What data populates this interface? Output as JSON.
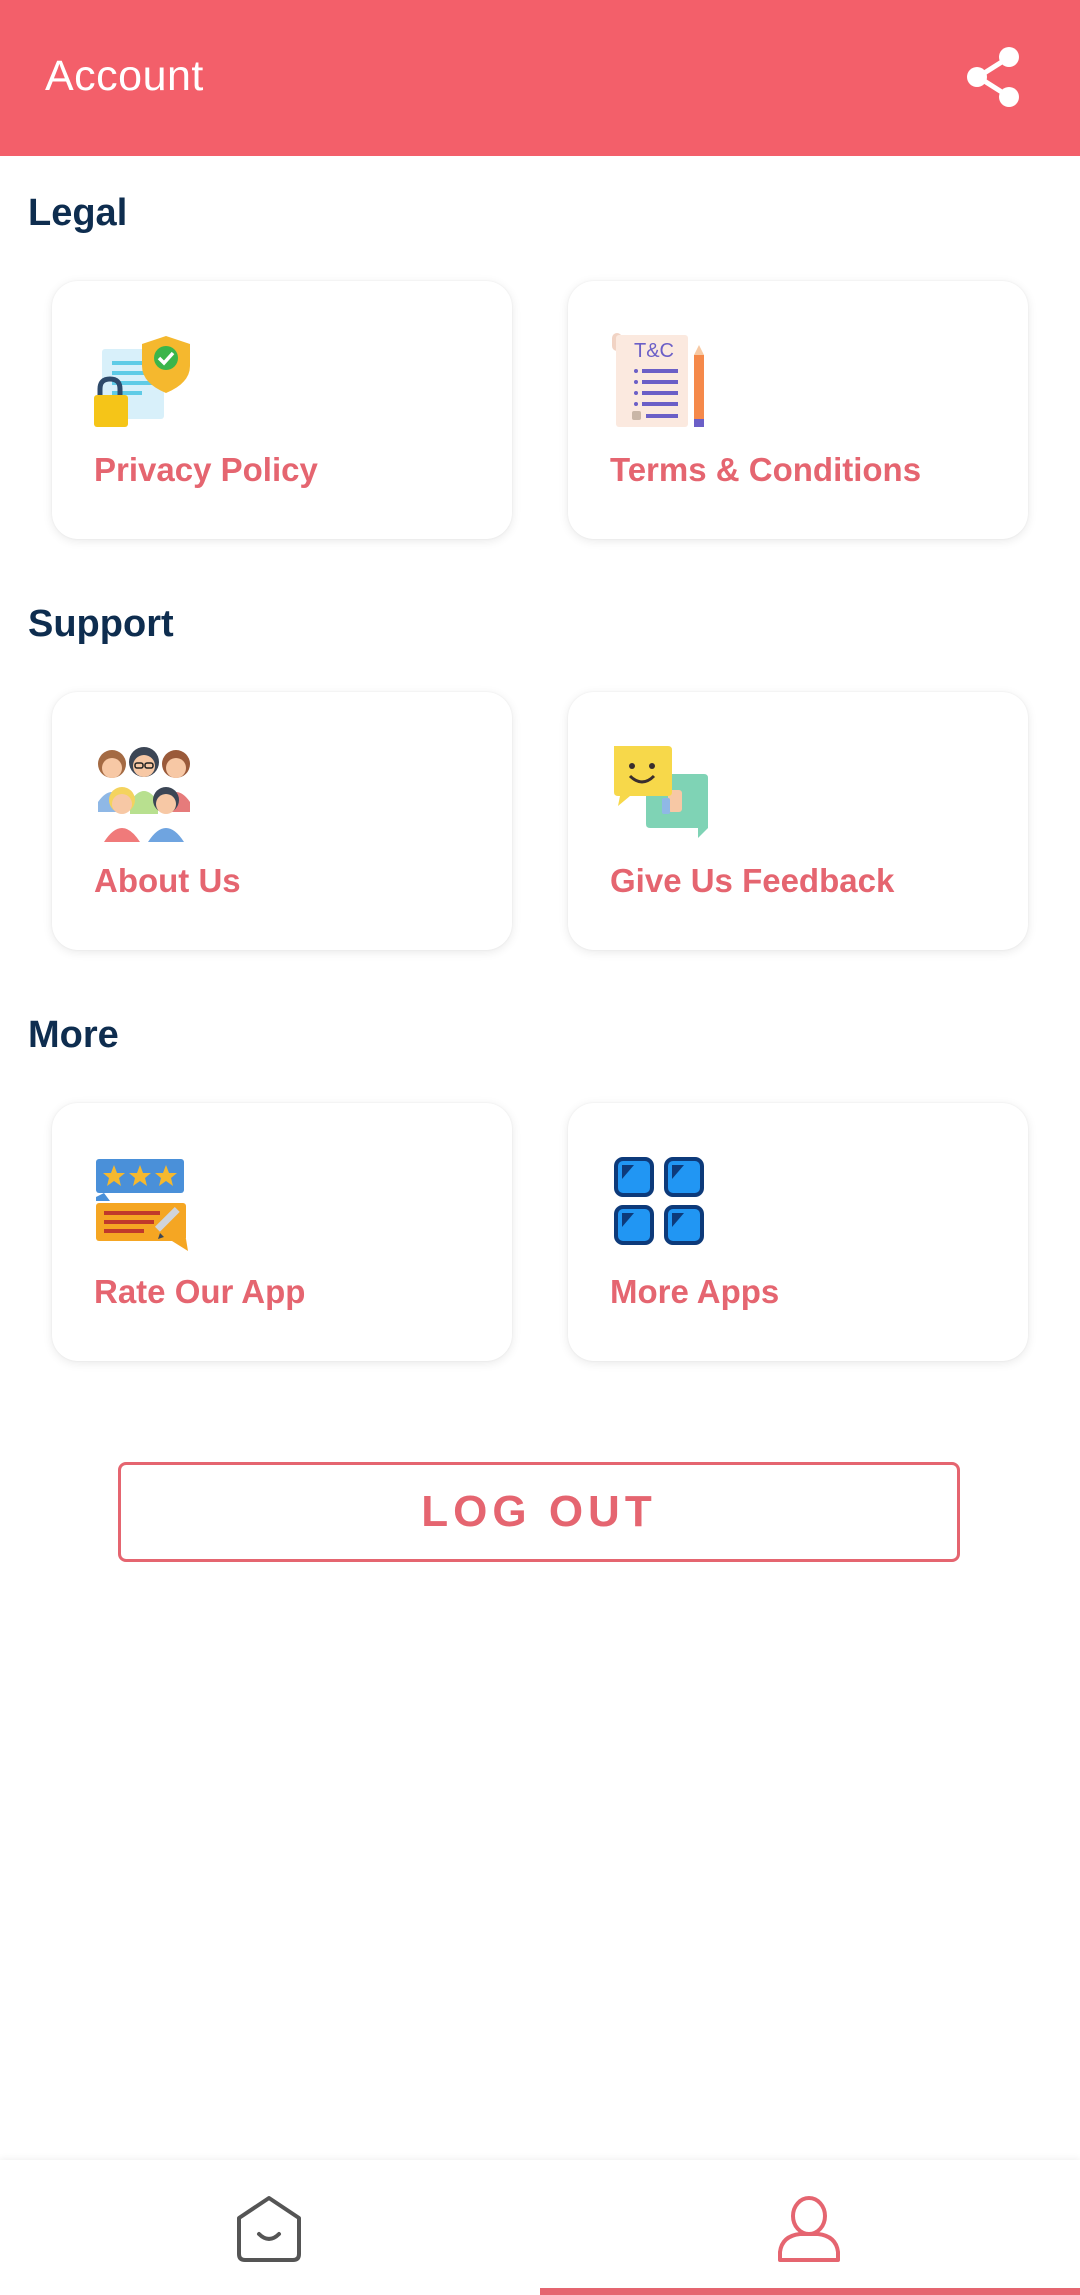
{
  "header": {
    "title": "Account",
    "share_icon": "share-icon"
  },
  "sections": {
    "legal": {
      "title": "Legal",
      "items": [
        {
          "label": "Privacy Policy",
          "icon": "privacy-policy-icon"
        },
        {
          "label": "Terms & Conditions",
          "icon": "terms-document-icon"
        }
      ]
    },
    "support": {
      "title": "Support",
      "items": [
        {
          "label": "About Us",
          "icon": "team-people-icon"
        },
        {
          "label": "Give Us Feedback",
          "icon": "feedback-chat-icon"
        }
      ]
    },
    "more": {
      "title": "More",
      "items": [
        {
          "label": "Rate Our App",
          "icon": "rating-stars-icon"
        },
        {
          "label": "More Apps",
          "icon": "apps-grid-icon"
        }
      ]
    }
  },
  "logout": {
    "label": "LOG OUT"
  },
  "bottom_nav": {
    "tabs": [
      {
        "icon": "home-bag-icon",
        "active": false
      },
      {
        "icon": "profile-icon",
        "active": true
      }
    ]
  },
  "colors": {
    "primary": "#f35f6a",
    "accent_text": "#e56570",
    "heading": "#0e2d4f"
  }
}
